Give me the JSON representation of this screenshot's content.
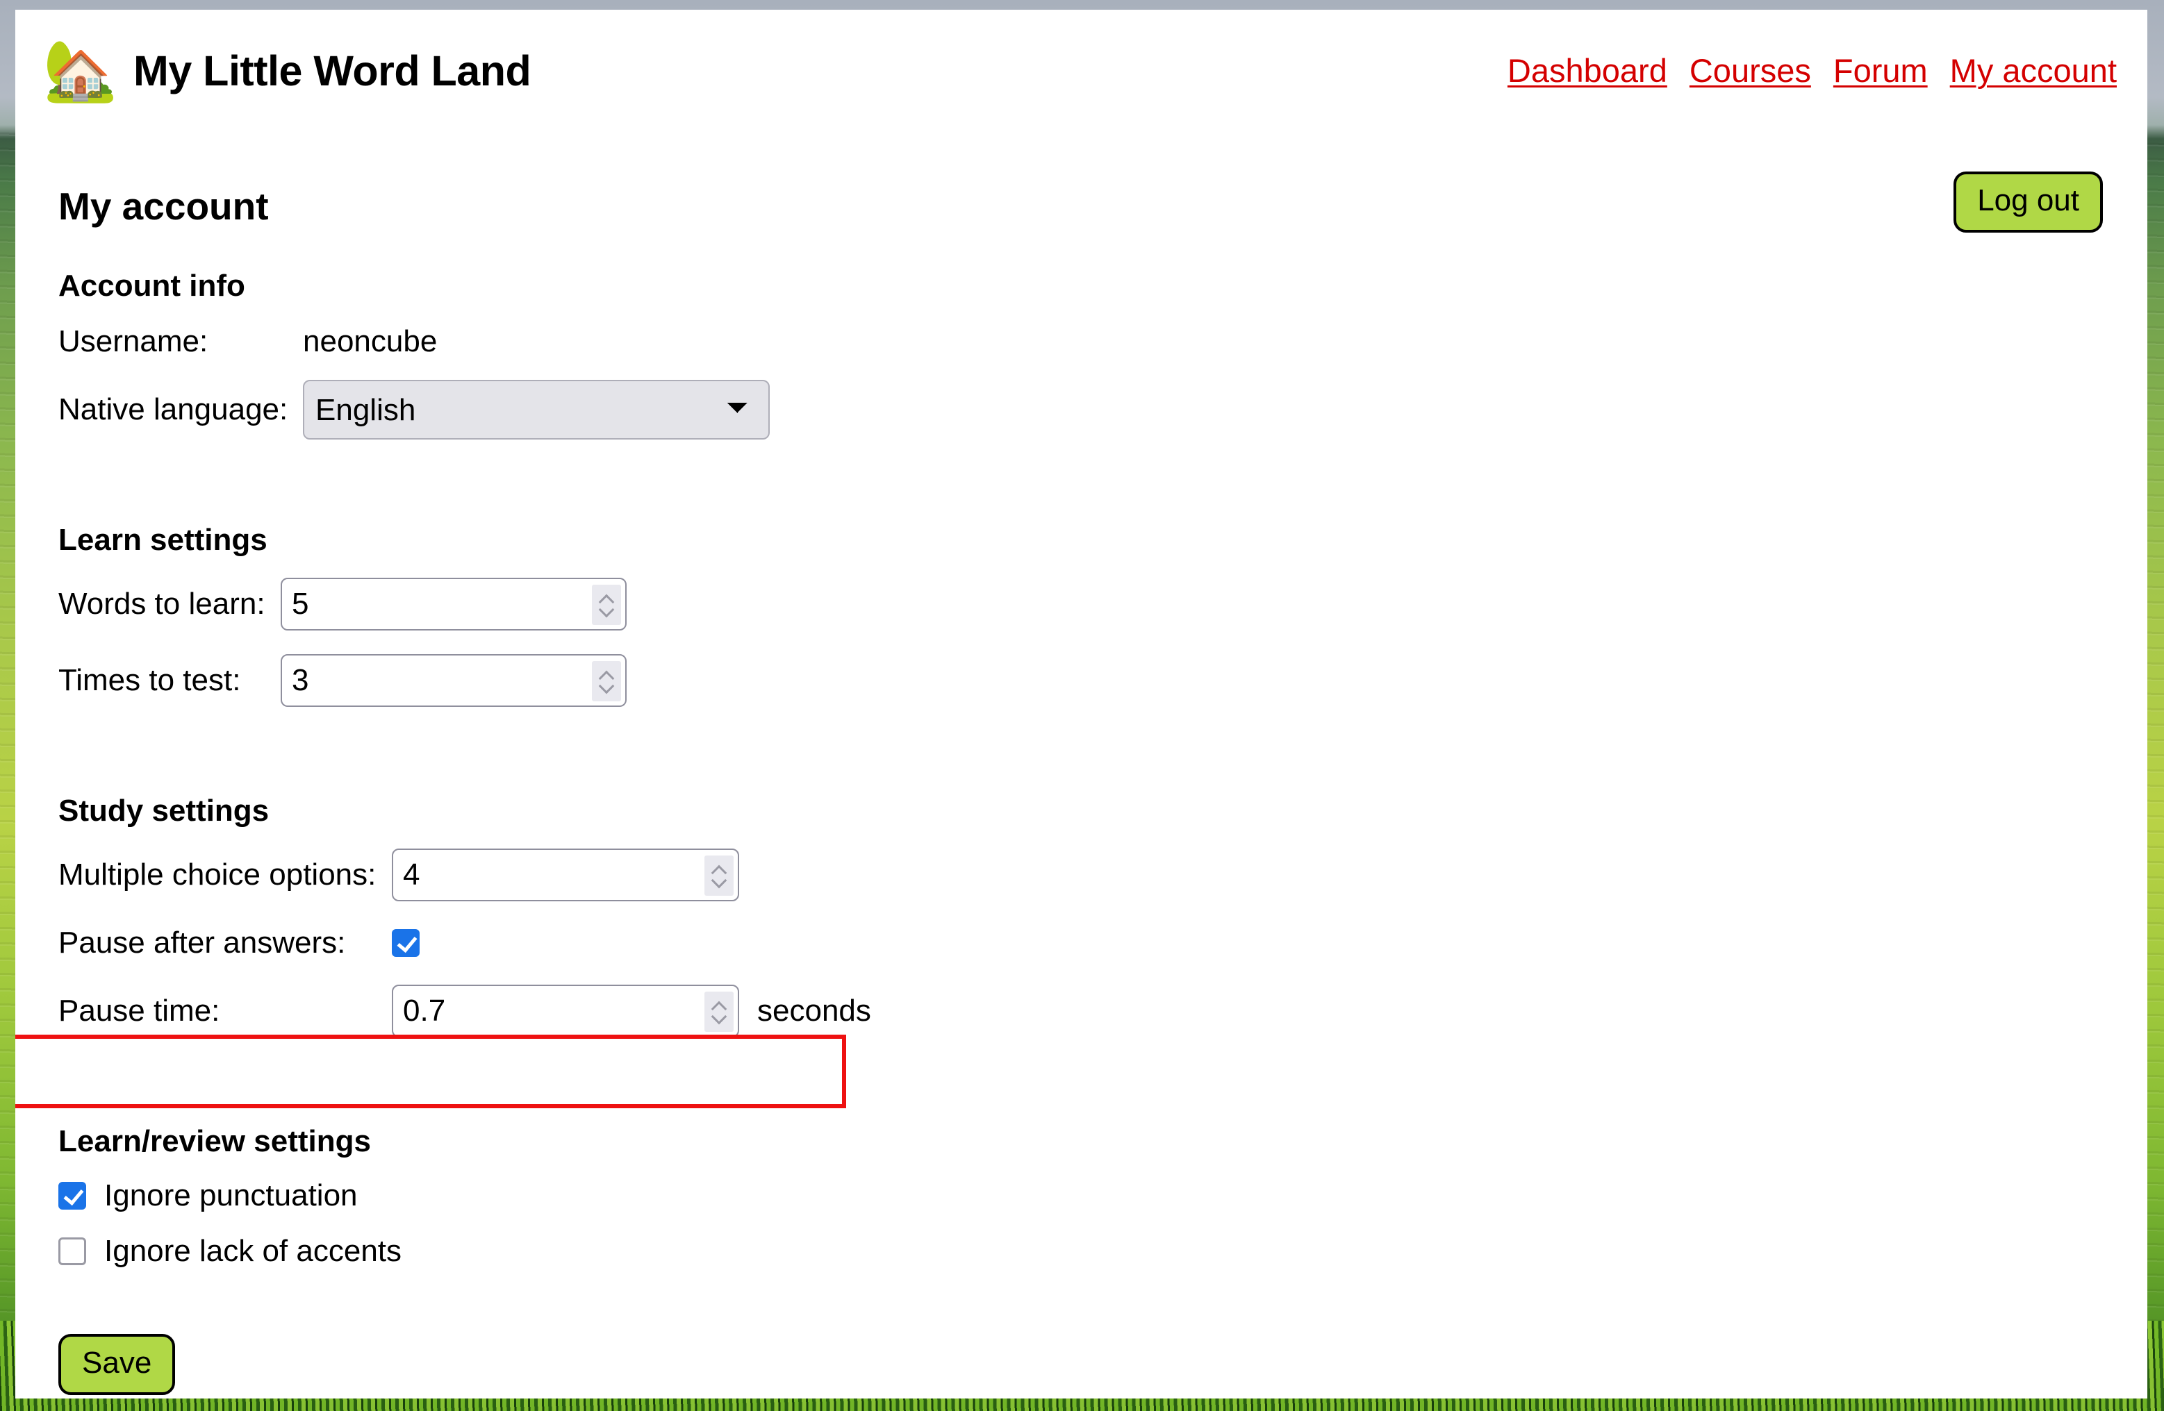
{
  "header": {
    "logo_icon": "house-with-tree-icon",
    "site_title": "My Little Word Land",
    "nav": [
      {
        "label": "Dashboard",
        "name": "nav-dashboard"
      },
      {
        "label": "Courses",
        "name": "nav-courses"
      },
      {
        "label": "Forum",
        "name": "nav-forum"
      },
      {
        "label": "My account",
        "name": "nav-my-account"
      }
    ]
  },
  "page": {
    "title": "My account",
    "logout_label": "Log out",
    "save_label": "Save"
  },
  "account_info": {
    "heading": "Account info",
    "username_label": "Username:",
    "username_value": "neoncube",
    "native_language_label": "Native language:",
    "native_language_value": "English",
    "native_language_options": [
      "English"
    ]
  },
  "learn_settings": {
    "heading": "Learn settings",
    "words_to_learn_label": "Words to learn:",
    "words_to_learn_value": "5",
    "times_to_test_label": "Times to test:",
    "times_to_test_value": "3"
  },
  "study_settings": {
    "heading": "Study settings",
    "multiple_choice_label": "Multiple choice options:",
    "multiple_choice_value": "4",
    "pause_after_answers_label": "Pause after answers:",
    "pause_after_answers_checked": true,
    "pause_time_label": "Pause time:",
    "pause_time_value": "0.7",
    "pause_time_unit": "seconds"
  },
  "learn_review_settings": {
    "heading": "Learn/review settings",
    "ignore_punctuation_label": "Ignore punctuation",
    "ignore_punctuation_checked": true,
    "ignore_accents_label": "Ignore lack of accents",
    "ignore_accents_checked": false
  },
  "colors": {
    "link": "#d40000",
    "button_green": "#b0d846",
    "checkbox_blue": "#1a73e8",
    "highlight_red": "#ee1111"
  }
}
